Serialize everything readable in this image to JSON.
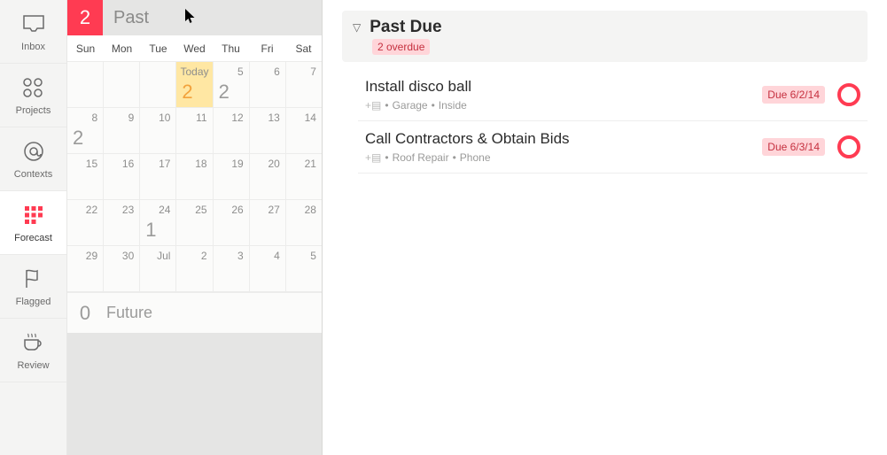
{
  "sidebar": {
    "items": [
      {
        "label": "Inbox"
      },
      {
        "label": "Projects"
      },
      {
        "label": "Contexts"
      },
      {
        "label": "Forecast"
      },
      {
        "label": "Flagged"
      },
      {
        "label": "Review"
      }
    ]
  },
  "calendar": {
    "past_count": "2",
    "past_label": "Past",
    "future_count": "0",
    "future_label": "Future",
    "dow": [
      "Sun",
      "Mon",
      "Tue",
      "Wed",
      "Thu",
      "Fri",
      "Sat"
    ],
    "today_label": "Today",
    "weeks": [
      [
        {
          "dn": "",
          "val": ""
        },
        {
          "dn": "",
          "val": ""
        },
        {
          "dn": "",
          "val": ""
        },
        {
          "dn": "",
          "val": "2",
          "today": true,
          "label": "Today"
        },
        {
          "dn": "5",
          "val": "2"
        },
        {
          "dn": "6",
          "val": ""
        },
        {
          "dn": "7",
          "val": ""
        }
      ],
      [
        {
          "dn": "8",
          "val": "2"
        },
        {
          "dn": "9",
          "val": ""
        },
        {
          "dn": "10",
          "val": ""
        },
        {
          "dn": "11",
          "val": ""
        },
        {
          "dn": "12",
          "val": ""
        },
        {
          "dn": "13",
          "val": ""
        },
        {
          "dn": "14",
          "val": ""
        }
      ],
      [
        {
          "dn": "15",
          "val": ""
        },
        {
          "dn": "16",
          "val": ""
        },
        {
          "dn": "17",
          "val": ""
        },
        {
          "dn": "18",
          "val": ""
        },
        {
          "dn": "19",
          "val": ""
        },
        {
          "dn": "20",
          "val": ""
        },
        {
          "dn": "21",
          "val": ""
        }
      ],
      [
        {
          "dn": "22",
          "val": ""
        },
        {
          "dn": "23",
          "val": ""
        },
        {
          "dn": "24",
          "val": "1"
        },
        {
          "dn": "25",
          "val": ""
        },
        {
          "dn": "26",
          "val": ""
        },
        {
          "dn": "27",
          "val": ""
        },
        {
          "dn": "28",
          "val": ""
        }
      ],
      [
        {
          "dn": "29",
          "val": ""
        },
        {
          "dn": "30",
          "val": ""
        },
        {
          "dn": "Jul",
          "val": ""
        },
        {
          "dn": "2",
          "val": ""
        },
        {
          "dn": "3",
          "val": ""
        },
        {
          "dn": "4",
          "val": ""
        },
        {
          "dn": "5",
          "val": ""
        }
      ]
    ]
  },
  "section": {
    "title": "Past Due",
    "subtitle": "2 overdue"
  },
  "tasks": [
    {
      "title": "Install disco ball",
      "project": "Garage",
      "context": "Inside",
      "due": "Due 6/2/14"
    },
    {
      "title": "Call Contractors & Obtain Bids",
      "project": "Roof Repair",
      "context": "Phone",
      "due": "Due 6/3/14"
    }
  ],
  "meta_sep": "•"
}
